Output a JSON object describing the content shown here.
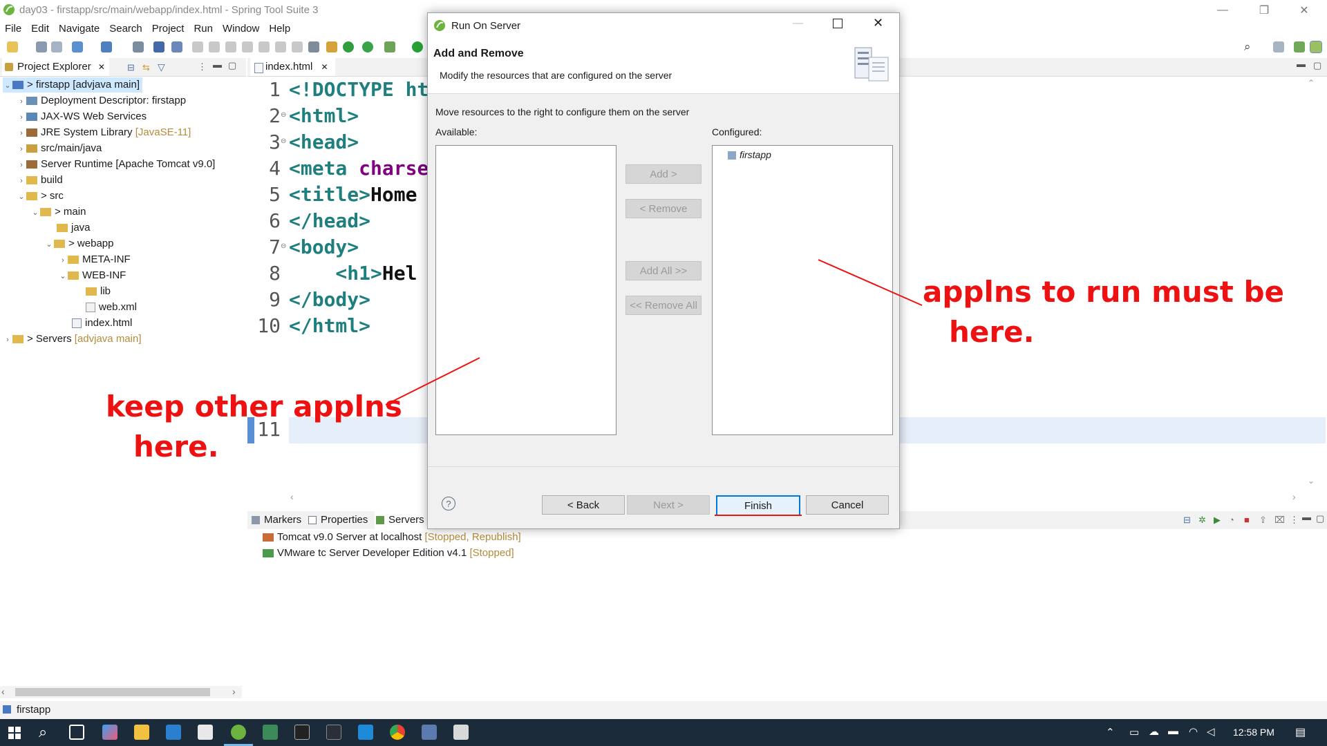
{
  "window": {
    "title": "day03 - firstapp/src/main/webapp/index.html - Spring Tool Suite 3",
    "minimize": "—",
    "restore": "❐",
    "close": "✕"
  },
  "menu": [
    "File",
    "Edit",
    "Navigate",
    "Search",
    "Project",
    "Run",
    "Window",
    "Help"
  ],
  "project_explorer": {
    "tab_label": "Project Explorer",
    "tab_close": "✕",
    "tree": [
      {
        "label": "> firstapp",
        "deco": " [advjava main]"
      },
      {
        "label": "Deployment Descriptor: firstapp",
        "deco": ""
      },
      {
        "label": "JAX-WS Web Services",
        "deco": ""
      },
      {
        "label": "JRE System Library",
        "deco": " [JavaSE-11]"
      },
      {
        "label": "src/main/java",
        "deco": ""
      },
      {
        "label": "Server Runtime [Apache Tomcat v9.0]",
        "deco": ""
      },
      {
        "label": "build",
        "deco": ""
      },
      {
        "label": "> src",
        "deco": ""
      },
      {
        "label": "> main",
        "deco": ""
      },
      {
        "label": "java",
        "deco": ""
      },
      {
        "label": "> webapp",
        "deco": ""
      },
      {
        "label": "META-INF",
        "deco": ""
      },
      {
        "label": "WEB-INF",
        "deco": ""
      },
      {
        "label": "lib",
        "deco": ""
      },
      {
        "label": "web.xml",
        "deco": ""
      },
      {
        "label": "index.html",
        "deco": ""
      },
      {
        "label": "> Servers",
        "deco": " [advjava main]"
      }
    ]
  },
  "editor": {
    "tab_label": "index.html",
    "tab_close": "✕",
    "lines": [
      {
        "n": "1",
        "fold": "",
        "t": "<!DOCTYPE ht",
        "a": "",
        "p": ""
      },
      {
        "n": "2",
        "fold": "⊖",
        "t": "<html>",
        "a": "",
        "p": ""
      },
      {
        "n": "3",
        "fold": "⊖",
        "t": "<head>",
        "a": "",
        "p": ""
      },
      {
        "n": "4",
        "fold": "",
        "t": "<meta ",
        "a": "charse",
        "p": ""
      },
      {
        "n": "5",
        "fold": "",
        "t": "<title>",
        "a": "",
        "p": "Home"
      },
      {
        "n": "6",
        "fold": "",
        "t": "</head>",
        "a": "",
        "p": ""
      },
      {
        "n": "7",
        "fold": "⊖",
        "t": "<body>",
        "a": "",
        "p": ""
      },
      {
        "n": "8",
        "fold": "",
        "t": "    <h1>",
        "a": "",
        "p": "Hel"
      },
      {
        "n": "9",
        "fold": "",
        "t": "</body>",
        "a": "",
        "p": ""
      },
      {
        "n": "10",
        "fold": "",
        "t": "</html>",
        "a": "",
        "p": ""
      },
      {
        "n": "11",
        "fold": "",
        "t": "",
        "a": "",
        "p": ""
      }
    ]
  },
  "bottom_panel": {
    "tabs": [
      "Markers",
      "Properties",
      "Servers"
    ],
    "servers": [
      {
        "name": "Tomcat v9.0 Server at localhost",
        "state": "[Stopped, Republish]"
      },
      {
        "name": "VMware tc Server Developer Edition v4.1",
        "state": "[Stopped]"
      }
    ]
  },
  "dialog": {
    "title": "Run On Server",
    "heading": "Add and Remove",
    "description": "Modify the resources that are configured on the server",
    "instruction": "Move resources to the right to configure them on the server",
    "available_label": "Available:",
    "configured_label": "Configured:",
    "configured_items": [
      "firstapp"
    ],
    "buttons": {
      "add": "Add >",
      "remove": "< Remove",
      "add_all": "Add All >>",
      "remove_all": "<< Remove All",
      "back": "< Back",
      "next": "Next >",
      "finish": "Finish",
      "cancel": "Cancel"
    },
    "help": "?"
  },
  "annotations": {
    "left_line1": "keep other applns",
    "left_line2": "here.",
    "right_line1": "applns to run must be",
    "right_line2": "here."
  },
  "statusbar": {
    "selection": "firstapp"
  },
  "taskbar": {
    "time": "12:58 PM"
  },
  "colors": {
    "annotation": "#ee1111",
    "accent": "#0078d7",
    "tag": "#1f7f7f",
    "attr": "#7f007f"
  }
}
